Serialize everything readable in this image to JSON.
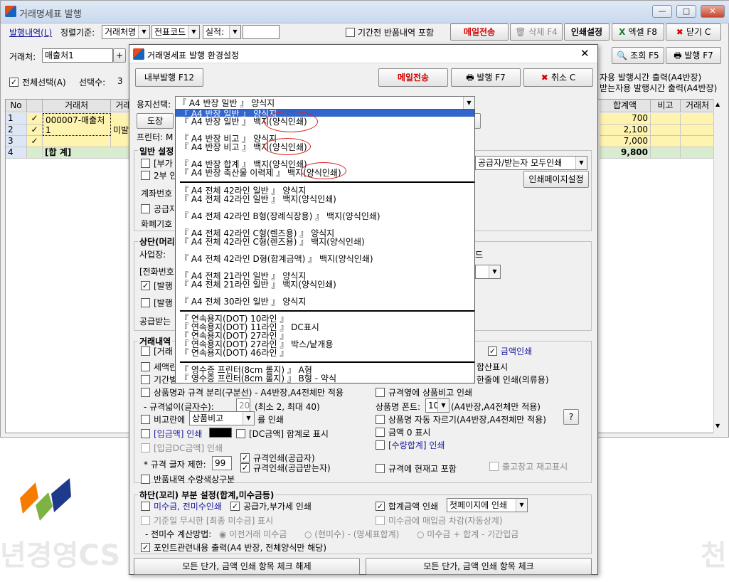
{
  "main": {
    "title": "거래명세표 발행",
    "window_buttons": [
      "—",
      "□",
      "✕"
    ],
    "toolbar1": {
      "issue_history": "발행내역(L)",
      "sort_label": "정렬기준:",
      "sort1": "거래처명",
      "sort2": "전표코드",
      "sort3": "실적:",
      "sort4": "",
      "include_returns": "기간전 반품내역 포함",
      "mail_send": "메일전송",
      "delete": "삭제 F4",
      "print_settings": "인쇄설정",
      "excel": "엑셀 F8",
      "close": "닫기 C"
    },
    "toolbar2": {
      "client_label": "거래처:",
      "client_value": "매출처1",
      "plus": "+",
      "search": "조회 F5",
      "issue": "발행 F7"
    },
    "toolbar3": {
      "select_all": "전체선택(A)",
      "selected_count_label": "선택수:",
      "selected_count": "3",
      "right_line1": "자용 발행시간 출력(A4반장)",
      "right_line2": "받는자용 발행시간 출력(A4반장)"
    },
    "grid": {
      "headers": [
        "No",
        "",
        "거래처",
        "거래"
      ],
      "right_headers": [
        "합계액",
        "비고",
        "거래처"
      ],
      "rows": [
        {
          "no": "1",
          "checked": "✓",
          "client": "000007-매출처1",
          "extra": "미발",
          "total": "700"
        },
        {
          "no": "2",
          "checked": "✓",
          "client": "",
          "extra": "",
          "total": "2,100"
        },
        {
          "no": "3",
          "checked": "✓",
          "client": "",
          "extra": "",
          "total": "7,000"
        },
        {
          "no": "4",
          "checked": "",
          "client": "[합 계]",
          "extra": "",
          "total": "9,800"
        }
      ]
    },
    "watermark_left": "년경영CS",
    "watermark_right": "천"
  },
  "dialog": {
    "title": "거래명세표 발행 환경설정",
    "close": "✕",
    "internal_issue": "내부발행 F12",
    "mail_send": "메일전송",
    "issue": "발행 F7",
    "cancel": "취소 C",
    "paper_label": "용지선택:",
    "paper_value": "『 A4 반장 일반 』 양식지",
    "stamp": "도장",
    "printer_label": "프린터: M",
    "dropdown_items": [
      "『 A4 반장 일반 』 양식지",
      "『 A4 반장 일반 』 백지(양식인쇄)",
      "『 A4 반장 비고 』 양식지",
      "『 A4 반장 비고 』 백지(양식인쇄)",
      "『 A4 반장 합계 』 백지(양식인쇄)",
      "『 A4 반장 축산물 이력제 』 백지(양식인쇄)",
      "『 A4 전체 42라인 일반 』 양식지",
      "『 A4 전체 42라인 일반 』 백지(양식인쇄)",
      "『 A4 전체 42라인  B형(장례식장용) 』 백지(양식인쇄)",
      "『 A4 전체 42라인  C형(렌즈용) 』 양식지",
      "『 A4 전체 42라인  C형(렌즈용) 』 백지(양식인쇄)",
      "『 A4 전체 42라인  D형(합계금액) 』 백지(양식인쇄)",
      "『 A4 전체 21라인 일반 』 양식지",
      "『 A4 전체 21라인 일반 』 백지(양식인쇄)",
      "『 A4 전체 30라인 일반 』 양식지",
      "『 연속용지(DOT) 10라인 』",
      "『 연속용지(DOT) 11라인 』 DC표시",
      "『 연속용지(DOT) 27라인 』",
      "『 연속용지(DOT) 27라인 』 박스/낱개용",
      "『 연속용지(DOT) 46라인 』",
      "『 영수증 프린터(8cm 롤지) 』 A형",
      "『 영수증 프린터(8cm 롤지) 』 B형 - 약식"
    ],
    "general": {
      "title": "일반 설정",
      "vat": "[부가",
      "two_part": "2부 인",
      "account": "계좌번호",
      "supplier": "공급자",
      "currency": "화폐기호",
      "print_mode": "공급자/받는자 모두인쇄",
      "page_settings": "인쇄페이지설정"
    },
    "top": {
      "title": "상단(머리",
      "business": "사업장:",
      "phone": "[전화번호",
      "issue1": "[발행",
      "issue2": "[발행",
      "receiver": "공급받는",
      "right_char": "드"
    },
    "detail": {
      "title": "거래내역",
      "item1": "[거래",
      "item2": "세액란",
      "item3": "기간별",
      "amount_print": "금액인쇄",
      "total_disp": "합산표시",
      "one_line": "한줄에 인쇄(의류용)",
      "split": "상품명과 규격 분리(구분선) - A4반장,A4전체만 적용",
      "spec_width_label": "- 규격넓이(글자수):",
      "spec_width_value": "20",
      "spec_width_hint": "(최소 2, 최대 40)",
      "remark_label": "비고란에",
      "remark_value": "상품비고",
      "remark_suffix": "를 인쇄",
      "deposit": "[입금액] 인쇄",
      "dc": "[DC금액] 합계로 표시",
      "deposit_dc": "[입금DC금액] 인쇄",
      "limit_label": "* 규격 글자 제한:",
      "limit_value": "99",
      "spec_supplier": "규격인쇄(공급자)",
      "spec_receiver": "규격인쇄(공급받는자)",
      "return_color": "반품내역 수량색상구분",
      "spec_remark": "규격옆에 상품비고 인쇄",
      "font_label": "상품명 폰트:",
      "font_value": "10",
      "font_hint": "(A4반장,A4전체만 적용)",
      "auto_cut": "상품명 자동 자르기(A4반장,A4전체만 적용)",
      "help": "?",
      "zero": "금액 0 표시",
      "qty_total": "[수량합계] 인쇄",
      "stock": "규격에 현재고 포함",
      "warehouse": "출고창고 재고표시"
    },
    "bottom": {
      "title": "하단(꼬리) 부분 설정(합계,미수금등)",
      "receivable": "미수금, 전미수인쇄",
      "supply_vat": "공급가,부가세 인쇄",
      "total_print": "합계금액 인쇄",
      "total_page": "첫페이지에 인쇄",
      "ignore": "기준일 무시한 [최종 미수금] 표시",
      "deduct": "미수금에 매입금 차감(자동상계)",
      "calc_label": "- 전미수 계산방법:",
      "calc1": "이전거래 미수금",
      "calc2": "(현미수) - (명세표합계)",
      "calc3": "미수금 + 합계 - 기간입금",
      "point": "포인트관련내용 출력(A4 반장, 전체양식만 해당)"
    },
    "uncheck_all": "모든 단가, 금액 인쇄 항목 체크 해제",
    "check_all": "모든 단가, 금액 인쇄 항목 체크"
  },
  "colors": {
    "row_yellow": "#fff3b0",
    "sum_green": "#d8ecd0",
    "red_ring": "#e02020",
    "red_text": "#d00000"
  }
}
